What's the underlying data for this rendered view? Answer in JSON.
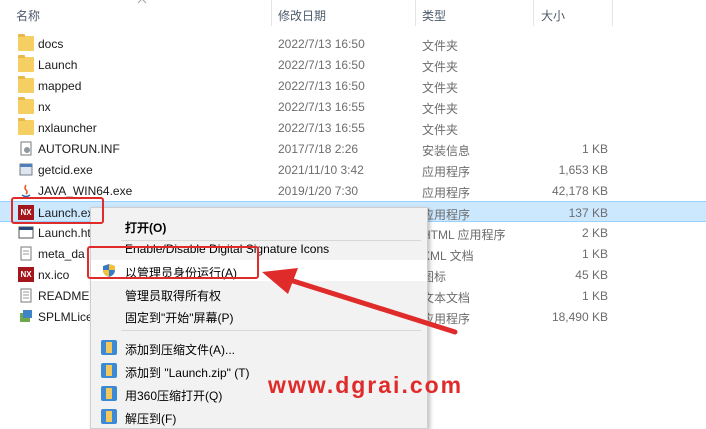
{
  "header": {
    "columns": [
      "名称",
      "修改日期",
      "类型",
      "大小"
    ]
  },
  "files": [
    {
      "name": "docs",
      "date": "2022/7/13 16:50",
      "type": "文件夹",
      "size": "",
      "icon": "folder-icon"
    },
    {
      "name": "Launch",
      "date": "2022/7/13 16:50",
      "type": "文件夹",
      "size": "",
      "icon": "folder-icon"
    },
    {
      "name": "mapped",
      "date": "2022/7/13 16:50",
      "type": "文件夹",
      "size": "",
      "icon": "folder-icon"
    },
    {
      "name": "nx",
      "date": "2022/7/13 16:55",
      "type": "文件夹",
      "size": "",
      "icon": "folder-icon"
    },
    {
      "name": "nxlauncher",
      "date": "2022/7/13 16:55",
      "type": "文件夹",
      "size": "",
      "icon": "folder-icon"
    },
    {
      "name": "AUTORUN.INF",
      "date": "2017/7/18 2:26",
      "type": "安装信息",
      "size": "1 KB",
      "icon": "inf-file-icon"
    },
    {
      "name": "getcid.exe",
      "date": "2021/11/10 3:42",
      "type": "应用程序",
      "size": "1,653 KB",
      "icon": "exe-icon"
    },
    {
      "name": "JAVA_WIN64.exe",
      "date": "2019/1/20 7:30",
      "type": "应用程序",
      "size": "42,178 KB",
      "icon": "java-icon"
    },
    {
      "name": "Launch.ex",
      "date": "",
      "type": "应用程序",
      "size": "137 KB",
      "icon": "nx-app-icon"
    },
    {
      "name": "Launch.htr",
      "date": "",
      "type": "HTML 应用程序",
      "size": "2 KB",
      "icon": "hta-icon"
    },
    {
      "name": "meta_da",
      "date": "",
      "type": "XML 文档",
      "size": "1 KB",
      "icon": "xml-icon"
    },
    {
      "name": "nx.ico",
      "date": "",
      "type": "图标",
      "size": "45 KB",
      "icon": "nx-app-icon"
    },
    {
      "name": "README",
      "date": "",
      "type": "文本文档",
      "size": "1 KB",
      "icon": "text-file-icon"
    },
    {
      "name": "SPLMLice",
      "date": "",
      "type": "应用程序",
      "size": "18,490 KB",
      "icon": "installer-icon"
    }
  ],
  "context_menu": {
    "items": [
      {
        "label": "打开(O)",
        "bold": true
      },
      {
        "label": "Enable/Disable Digital Signature Icons"
      },
      {
        "label": "以管理员身份运行(A)",
        "icon": "shield-icon"
      },
      {
        "label": "管理员取得所有权"
      },
      {
        "label": "固定到\"开始\"屏幕(P)"
      },
      {
        "label": "添加到压缩文件(A)...",
        "icon": "archive-icon"
      },
      {
        "label": "添加到 \"Launch.zip\" (T)",
        "icon": "archive-icon"
      },
      {
        "label": "用360压缩打开(Q)",
        "icon": "archive-icon"
      },
      {
        "label": "解压到(F)",
        "icon": "archive-icon"
      }
    ]
  },
  "watermark": "www.dgrai.com",
  "colors": {
    "annotation": "#e02b2b",
    "selection": "#cce8ff",
    "folder": "#f5cf62"
  }
}
